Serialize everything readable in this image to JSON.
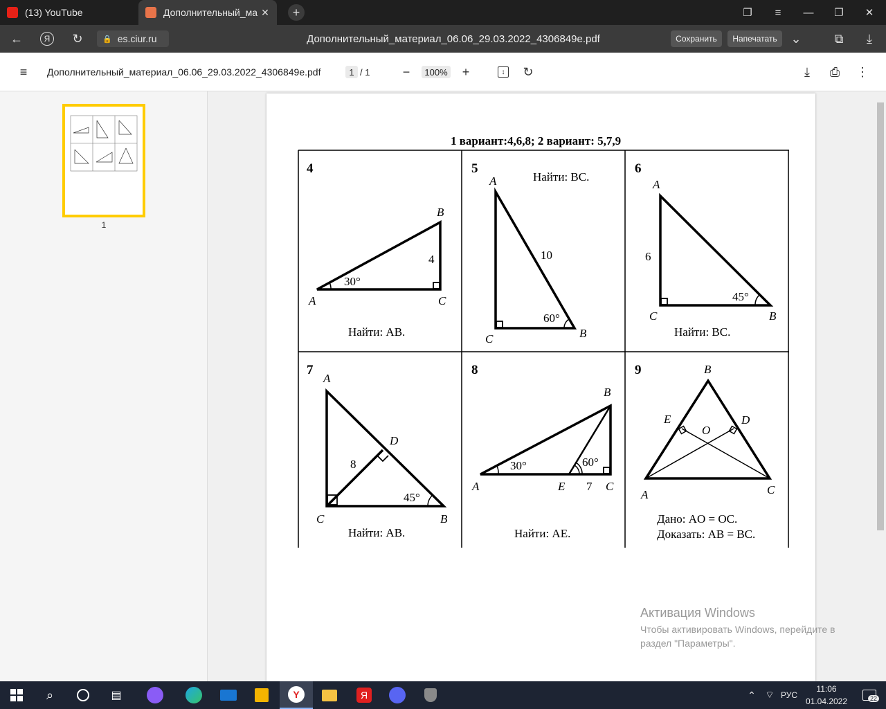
{
  "tabs": [
    {
      "label": "(13) YouTube",
      "icon": "youtube-icon"
    },
    {
      "label": "Дополнительный_мате",
      "icon": "pdf-icon"
    }
  ],
  "address": {
    "url": "es.ciur.ru",
    "doc_title": "Дополнительный_материал_06.06_29.03.2022_4306849e.pdf",
    "save_label": "Сохранить",
    "print_label": "Напечатать"
  },
  "pdf_toolbar": {
    "filename": "Дополнительный_материал_06.06_29.03.2022_4306849e.pdf",
    "page_current": "1",
    "page_total": "/ 1",
    "zoom": "100%"
  },
  "sidebar": {
    "thumb_page": "1"
  },
  "document": {
    "heading": "1 вариант:4,6,8; 2 вариант: 5,7,9",
    "problems": [
      {
        "num": "4",
        "task": "Найти: AB.",
        "labels": [
          "A",
          "B",
          "C"
        ],
        "angle": "30°",
        "side": "4"
      },
      {
        "num": "5",
        "task": "Найти: BC.",
        "labels": [
          "A",
          "B",
          "C"
        ],
        "angle": "60°",
        "side": "10"
      },
      {
        "num": "6",
        "task": "Найти: BC.",
        "labels": [
          "A",
          "B",
          "C"
        ],
        "angle": "45°",
        "side": "6"
      },
      {
        "num": "7",
        "task": "Найти: AB.",
        "labels": [
          "A",
          "B",
          "C",
          "D"
        ],
        "angle": "45°",
        "side": "8"
      },
      {
        "num": "8",
        "task": "Найти: AE.",
        "labels": [
          "A",
          "B",
          "C",
          "E"
        ],
        "angle1": "30°",
        "angle2": "60°",
        "side": "7"
      },
      {
        "num": "9",
        "given": "Дано: AO = OC.",
        "prove": "Доказать: AB = BC.",
        "labels": [
          "A",
          "B",
          "C",
          "D",
          "E",
          "O"
        ]
      }
    ]
  },
  "activation": {
    "title": "Активация Windows",
    "subtitle": "Чтобы активировать Windows, перейдите в раздел \"Параметры\"."
  },
  "taskbar": {
    "lang": "РУС",
    "time": "11:06",
    "date": "01.04.2022",
    "notifications": "22"
  }
}
